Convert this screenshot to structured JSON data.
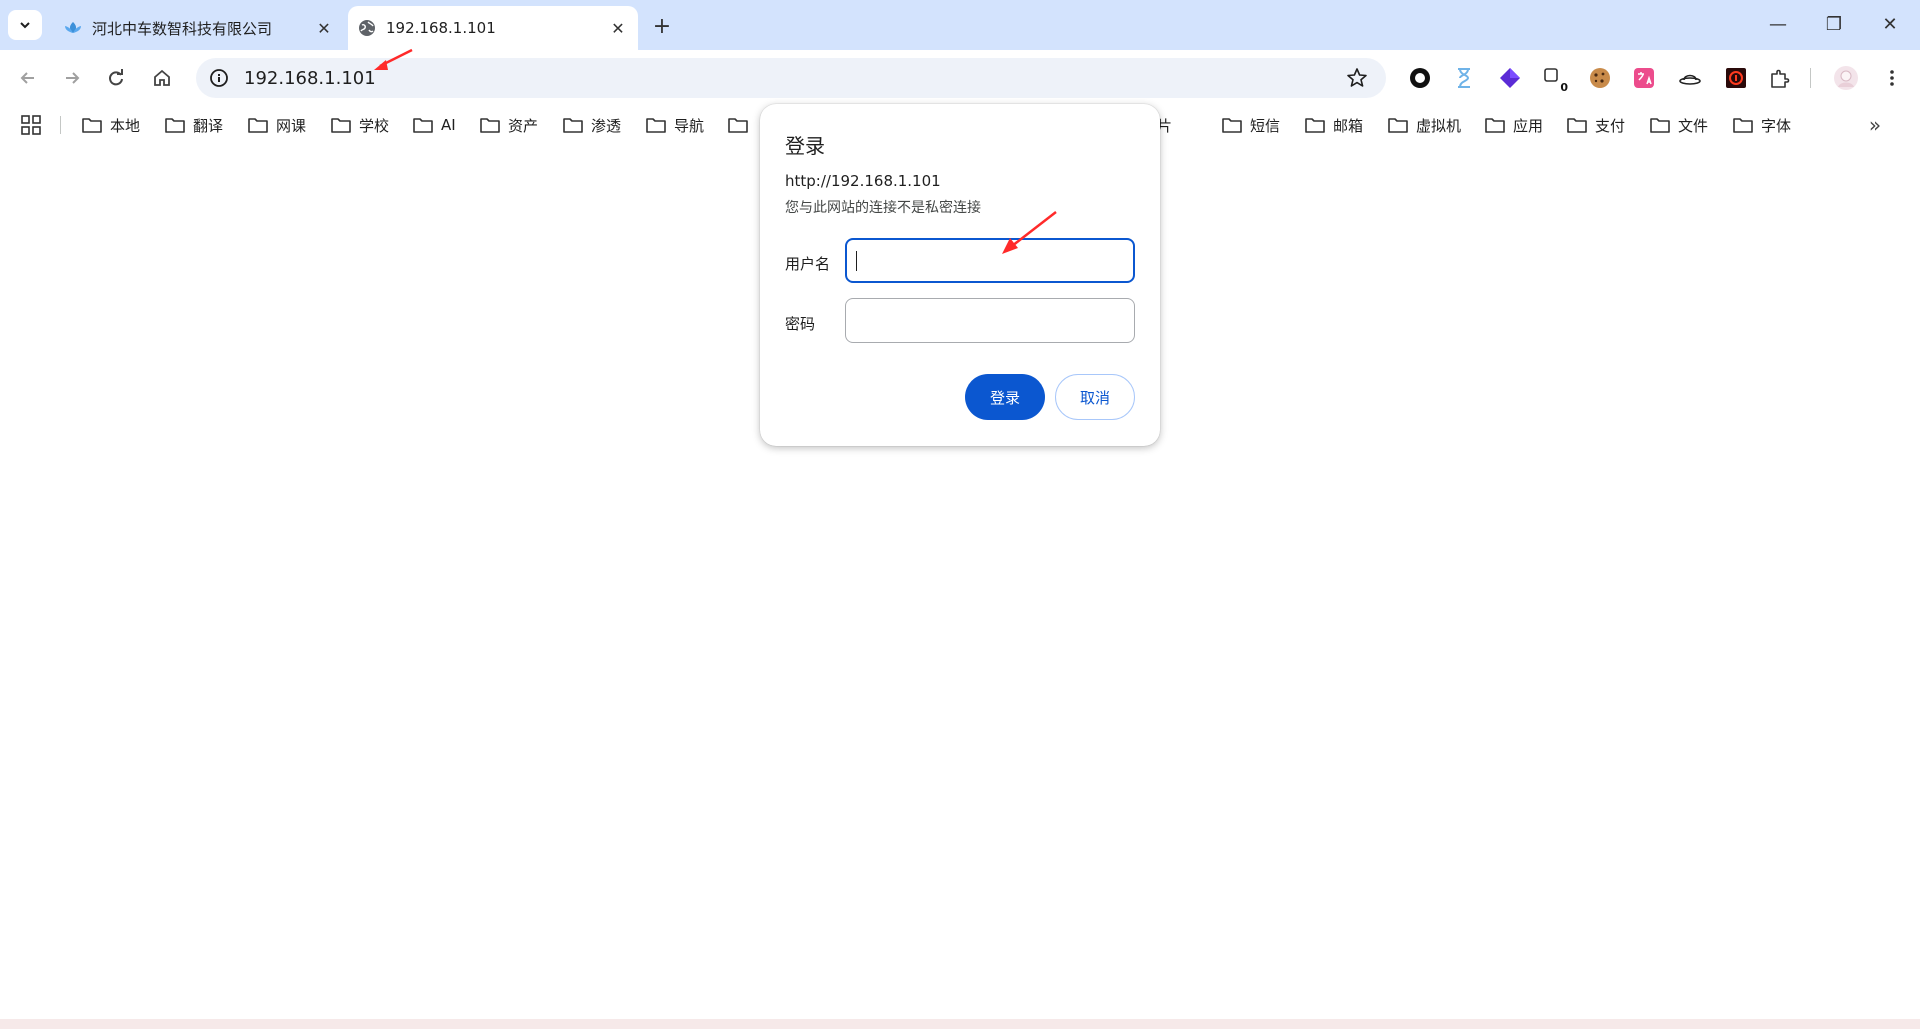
{
  "tabs": [
    {
      "title": "河北中车数智科技有限公司",
      "favicon": "lotus-icon",
      "active": false
    },
    {
      "title": "192.168.1.101",
      "favicon": "globe-icon",
      "active": true
    }
  ],
  "tab_close_glyph": "✕",
  "new_tab_glyph": "+",
  "window_controls": {
    "minimize": "—",
    "maximize": "❐",
    "close": "✕"
  },
  "address_bar": {
    "url": "192.168.1.101"
  },
  "extensions": [
    "circle-ext-icon",
    "hourglass-ext-icon",
    "cube-ext-icon",
    "counter-ext-icon",
    "cookie-ext-icon",
    "translate-ext-icon",
    "hat-ext-icon",
    "record-ext-icon",
    "puzzle-icon",
    "avatar"
  ],
  "extension_badge": "0",
  "bookmarks": [
    "本地",
    "翻译",
    "网课",
    "学校",
    "AI",
    "资产",
    "渗透",
    "导航",
    "",
    "图片",
    "短信",
    "邮箱",
    "虚拟机",
    "应用",
    "支付",
    "文件",
    "字体"
  ],
  "bookmarks_more": "»",
  "dialog": {
    "title": "登录",
    "origin": "http://192.168.1.101",
    "warning": "您与此网站的连接不是私密连接",
    "username_label": "用户名",
    "username_value": "",
    "password_label": "密码",
    "password_value": "",
    "login_button": "登录",
    "cancel_button": "取消"
  },
  "colors": {
    "accent": "#0b57d0",
    "titlebar": "#d3e3fd",
    "annotation_arrow": "#ff2a2a"
  }
}
